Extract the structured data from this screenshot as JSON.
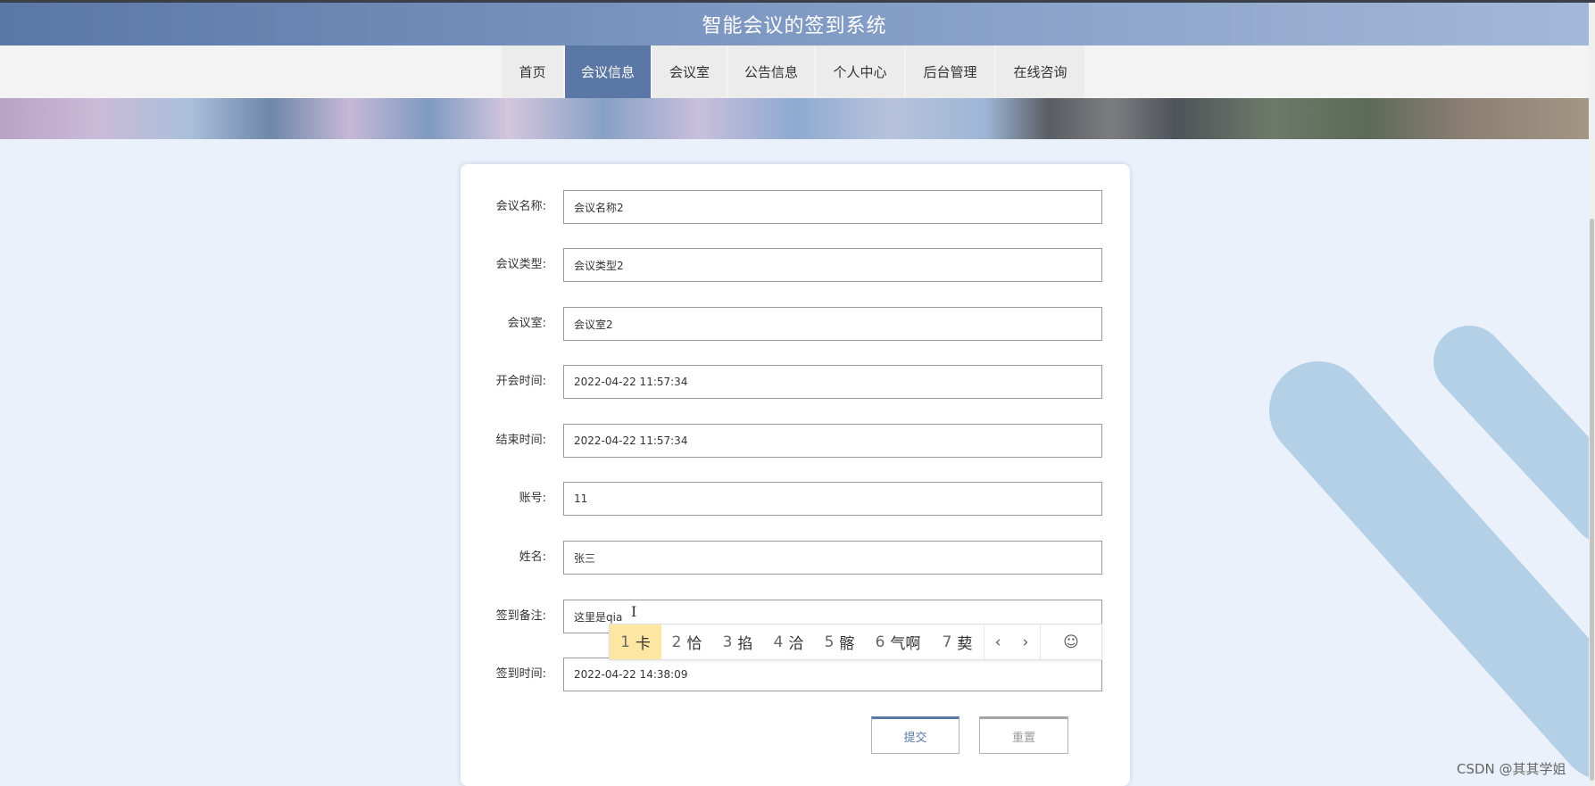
{
  "header": {
    "title": "智能会议的签到系统"
  },
  "nav": {
    "items": [
      {
        "label": "首页",
        "active": false
      },
      {
        "label": "会议信息",
        "active": true
      },
      {
        "label": "会议室",
        "active": false
      },
      {
        "label": "公告信息",
        "active": false
      },
      {
        "label": "个人中心",
        "active": false
      },
      {
        "label": "后台管理",
        "active": false
      },
      {
        "label": "在线咨询",
        "active": false
      }
    ]
  },
  "form": {
    "fields": [
      {
        "label": "会议名称:",
        "value": "会议名称2"
      },
      {
        "label": "会议类型:",
        "value": "会议类型2"
      },
      {
        "label": "会议室:",
        "value": "会议室2"
      },
      {
        "label": "开会时间:",
        "value": "2022-04-22 11:57:34"
      },
      {
        "label": "结束时间:",
        "value": "2022-04-22 11:57:34"
      },
      {
        "label": "账号:",
        "value": "11"
      },
      {
        "label": "姓名:",
        "value": "张三"
      },
      {
        "label": "签到备注:",
        "value": "这里是qia"
      },
      {
        "label": "签到时间:",
        "value": "2022-04-22 14:38:09"
      }
    ],
    "submit_label": "提交",
    "reset_label": "重置"
  },
  "ime": {
    "candidates": [
      {
        "num": "1",
        "text": "卡"
      },
      {
        "num": "2",
        "text": "恰"
      },
      {
        "num": "3",
        "text": "掐"
      },
      {
        "num": "4",
        "text": "洽"
      },
      {
        "num": "5",
        "text": "髂"
      },
      {
        "num": "6",
        "text": "气啊"
      },
      {
        "num": "7",
        "text": "葜"
      }
    ],
    "prev_icon": "chevron-left-icon",
    "next_icon": "chevron-right-icon",
    "emoji_icon": "smiley-icon"
  },
  "watermark": "CSDN @其其学姐",
  "colors": {
    "accent": "#5b77a6",
    "page_bg": "#eaf1fb",
    "ime_highlight": "#fde7a2",
    "deco_shape": "#b3d0e6"
  }
}
